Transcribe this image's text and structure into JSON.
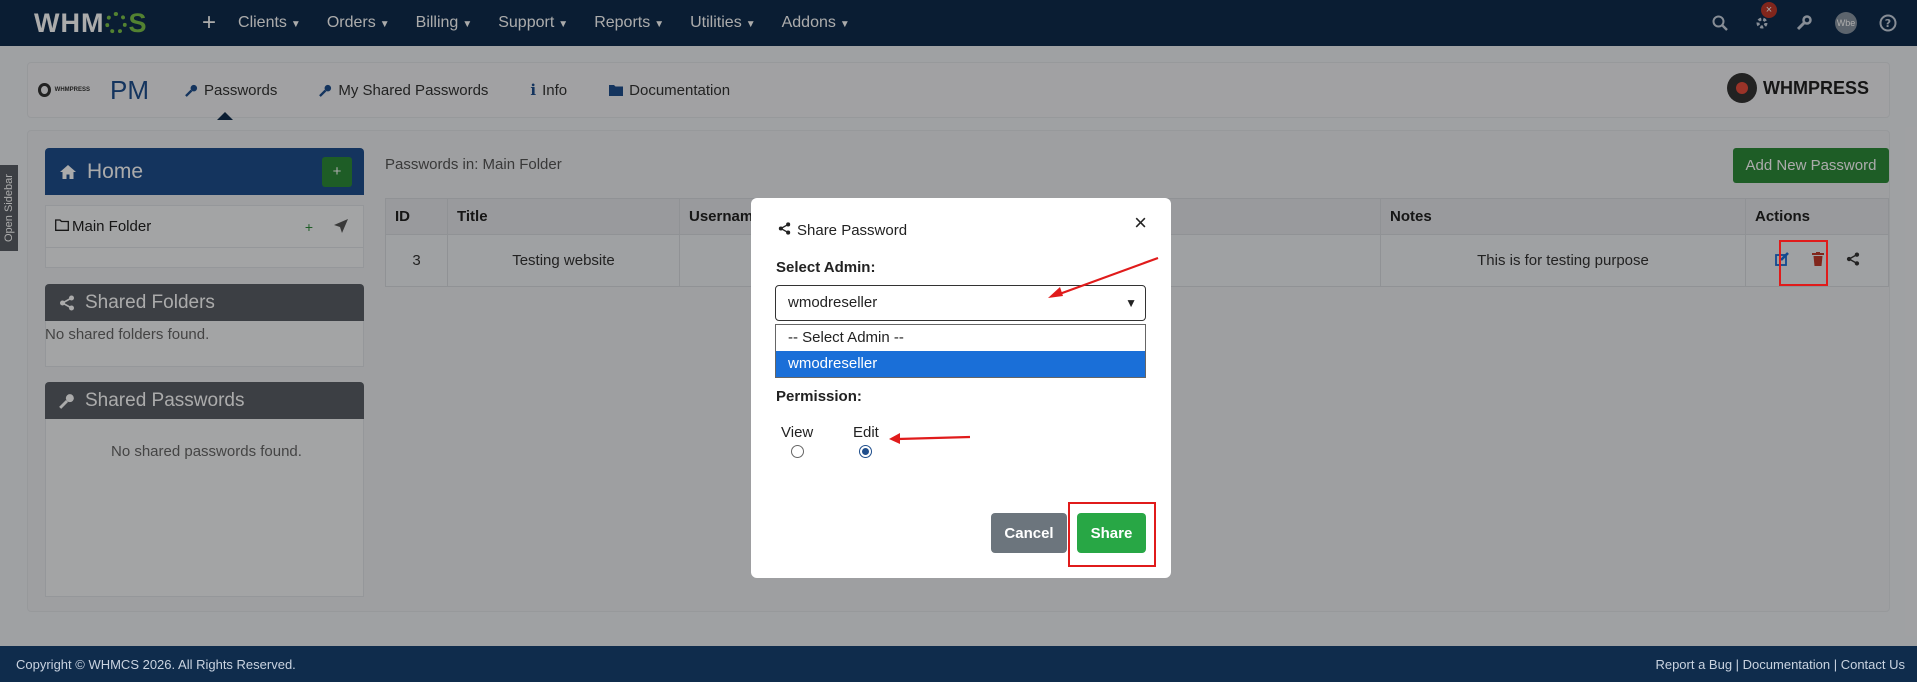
{
  "topbar": {
    "logo": "WHMCS",
    "logo_pre": "WHM",
    "logo_post": "S",
    "nav": [
      "Clients",
      "Orders",
      "Billing",
      "Support",
      "Reports",
      "Utilities",
      "Addons"
    ],
    "badge": "×",
    "avatar": "Wbe"
  },
  "subbar": {
    "brand_small": "WHMPRESS",
    "title": "PM",
    "links": [
      "Passwords",
      "My Shared Passwords",
      "Info",
      "Documentation"
    ],
    "brand": "WHMPRESS"
  },
  "sidebar": {
    "open_label": "Open Sidebar",
    "home": "Home",
    "add": "+",
    "folder": "Main Folder",
    "folder_add": "+",
    "shared_folders": "Shared Folders",
    "shared_folders_empty": "No shared folders found.",
    "shared_passwords": "Shared Passwords",
    "shared_passwords_empty": "No shared passwords found."
  },
  "content": {
    "passwords_in": "Passwords in: Main Folder",
    "add_button": "Add New Password",
    "columns": [
      "ID",
      "Title",
      "Username",
      "",
      "Notes",
      "Actions"
    ],
    "rows": [
      {
        "id": "3",
        "title": "Testing website",
        "username": "",
        "notes": "This is for testing purpose"
      }
    ]
  },
  "modal": {
    "title": "Share Password",
    "close": "×",
    "select_label": "Select Admin:",
    "selected": "wmodreseller",
    "options": [
      "-- Select Admin --",
      "wmodreseller"
    ],
    "permission_label": "Permission:",
    "view": "View",
    "edit": "Edit",
    "cancel": "Cancel",
    "share": "Share"
  },
  "footer": {
    "copyright": "Copyright © WHMCS 2026. All Rights Reserved.",
    "links": "Report a Bug | Documentation | Contact Us"
  },
  "colors": {
    "navy": "#0f2c4c",
    "blue": "#1f4e8c",
    "green": "#2e8b3a",
    "highlight": "#e01b1b"
  }
}
